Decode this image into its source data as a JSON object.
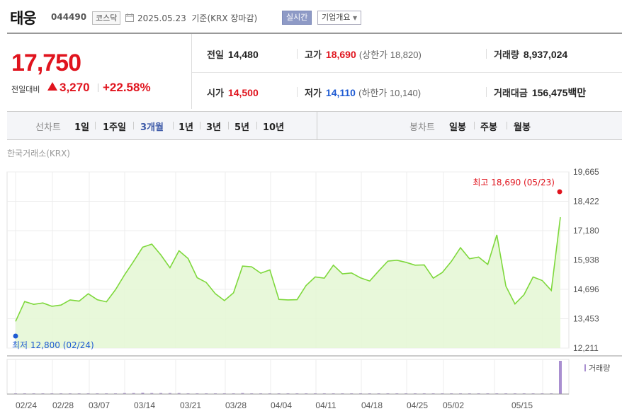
{
  "header": {
    "name": "태웅",
    "code": "044490",
    "market": "코스닥",
    "date": "2025.05.23",
    "basis": "기준(KRX 장마감)",
    "realtime_label": "실시간",
    "company_label": "기업개요"
  },
  "summary": {
    "price": "17,750",
    "change_label": "전일대비",
    "change_value": "3,270",
    "change_pct": "+22.58%",
    "prev_label": "전일",
    "prev_value": "14,480",
    "high_label": "고가",
    "high_value": "18,690",
    "upper_limit": "(상한가 18,820)",
    "volume_label": "거래량",
    "volume_value": "8,937,024",
    "open_label": "시가",
    "open_value": "14,500",
    "low_label": "저가",
    "low_value": "14,110",
    "lower_limit": "(하한가 10,140)",
    "amount_label": "거래대금",
    "amount_value": "156,475",
    "amount_unit": "백만"
  },
  "period_bar": {
    "line_label": "선차트",
    "line_periods": [
      "1일",
      "1주일",
      "3개월",
      "1년",
      "3년",
      "5년",
      "10년"
    ],
    "active": "3개월",
    "candle_label": "봉차트",
    "candle_periods": [
      "일봉",
      "주봉",
      "월봉"
    ]
  },
  "source": "한국거래소(KRX)",
  "colors": {
    "red": "#e0141e",
    "blue": "#1f5bd3",
    "line": "#7ed83c",
    "fill": "#e6f7d6"
  },
  "chart_data": {
    "type": "area",
    "y_ticks": [
      "19,665",
      "18,422",
      "17,180",
      "15,938",
      "14,696",
      "13,453",
      "12,211"
    ],
    "ylim": [
      12211,
      19665
    ],
    "x_tick_labels": [
      "02/24",
      "02/28",
      "03/07",
      "03/14",
      "03/21",
      "03/28",
      "04/04",
      "04/11",
      "04/18",
      "04/25",
      "05/02",
      "05/15"
    ],
    "high_label": "최고 18,690 (05/23)",
    "low_label": "최저 12,800 (02/24)",
    "volume_label": "거래량",
    "values": [
      13340,
      14180,
      14060,
      14120,
      13980,
      14030,
      14250,
      14200,
      14510,
      14260,
      14170,
      14680,
      15310,
      15880,
      16480,
      16610,
      16150,
      15610,
      16330,
      16000,
      15190,
      14990,
      14510,
      14220,
      14550,
      15680,
      15650,
      15380,
      15520,
      14270,
      14250,
      14260,
      14860,
      15220,
      15170,
      15720,
      15350,
      15390,
      15180,
      15050,
      15480,
      15890,
      15930,
      15840,
      15720,
      15730,
      15170,
      15410,
      15880,
      16460,
      15990,
      16060,
      15750,
      17000,
      14830,
      14080,
      14470,
      15220,
      15070,
      14650,
      17750
    ],
    "volume": [
      0.02,
      0.01,
      0.01,
      0.01,
      0.01,
      0.01,
      0.01,
      0.01,
      0.02,
      0.01,
      0.01,
      0.02,
      0.03,
      0.03,
      0.04,
      0.03,
      0.03,
      0.03,
      0.03,
      0.02,
      0.02,
      0.01,
      0.01,
      0.01,
      0.01,
      0.03,
      0.02,
      0.01,
      0.01,
      0.01,
      0.01,
      0.01,
      0.01,
      0.01,
      0.01,
      0.01,
      0.01,
      0.01,
      0.01,
      0.01,
      0.01,
      0.01,
      0.01,
      0.01,
      0.01,
      0.01,
      0.01,
      0.01,
      0.01,
      0.02,
      0.01,
      0.01,
      0.01,
      0.02,
      0.02,
      0.01,
      0.01,
      0.02,
      0.01,
      0.01,
      1.0
    ]
  }
}
